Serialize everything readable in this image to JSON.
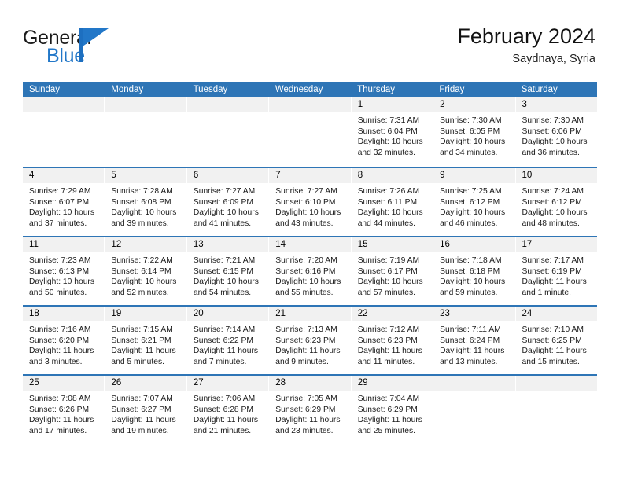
{
  "brand": {
    "name_top": "General",
    "name_bottom": "Blue",
    "mark": "triangle-logo",
    "accent_color": "#2277c8"
  },
  "header": {
    "title": "February 2024",
    "subtitle": "Saydnaya, Syria"
  },
  "theme": {
    "header_blue": "#2e75b6",
    "daynum_band": "#f1f1f1",
    "text": "#1a1a1a"
  },
  "weekdays": [
    "Sunday",
    "Monday",
    "Tuesday",
    "Wednesday",
    "Thursday",
    "Friday",
    "Saturday"
  ],
  "weeks": [
    {
      "days": [
        {
          "num": "",
          "sunrise": "",
          "sunset": "",
          "daylight": "",
          "empty": true
        },
        {
          "num": "",
          "sunrise": "",
          "sunset": "",
          "daylight": "",
          "empty": true
        },
        {
          "num": "",
          "sunrise": "",
          "sunset": "",
          "daylight": "",
          "empty": true
        },
        {
          "num": "",
          "sunrise": "",
          "sunset": "",
          "daylight": "",
          "empty": true
        },
        {
          "num": "1",
          "sunrise": "Sunrise: 7:31 AM",
          "sunset": "Sunset: 6:04 PM",
          "daylight": "Daylight: 10 hours and 32 minutes.",
          "empty": false
        },
        {
          "num": "2",
          "sunrise": "Sunrise: 7:30 AM",
          "sunset": "Sunset: 6:05 PM",
          "daylight": "Daylight: 10 hours and 34 minutes.",
          "empty": false
        },
        {
          "num": "3",
          "sunrise": "Sunrise: 7:30 AM",
          "sunset": "Sunset: 6:06 PM",
          "daylight": "Daylight: 10 hours and 36 minutes.",
          "empty": false
        }
      ]
    },
    {
      "days": [
        {
          "num": "4",
          "sunrise": "Sunrise: 7:29 AM",
          "sunset": "Sunset: 6:07 PM",
          "daylight": "Daylight: 10 hours and 37 minutes.",
          "empty": false
        },
        {
          "num": "5",
          "sunrise": "Sunrise: 7:28 AM",
          "sunset": "Sunset: 6:08 PM",
          "daylight": "Daylight: 10 hours and 39 minutes.",
          "empty": false
        },
        {
          "num": "6",
          "sunrise": "Sunrise: 7:27 AM",
          "sunset": "Sunset: 6:09 PM",
          "daylight": "Daylight: 10 hours and 41 minutes.",
          "empty": false
        },
        {
          "num": "7",
          "sunrise": "Sunrise: 7:27 AM",
          "sunset": "Sunset: 6:10 PM",
          "daylight": "Daylight: 10 hours and 43 minutes.",
          "empty": false
        },
        {
          "num": "8",
          "sunrise": "Sunrise: 7:26 AM",
          "sunset": "Sunset: 6:11 PM",
          "daylight": "Daylight: 10 hours and 44 minutes.",
          "empty": false
        },
        {
          "num": "9",
          "sunrise": "Sunrise: 7:25 AM",
          "sunset": "Sunset: 6:12 PM",
          "daylight": "Daylight: 10 hours and 46 minutes.",
          "empty": false
        },
        {
          "num": "10",
          "sunrise": "Sunrise: 7:24 AM",
          "sunset": "Sunset: 6:12 PM",
          "daylight": "Daylight: 10 hours and 48 minutes.",
          "empty": false
        }
      ]
    },
    {
      "days": [
        {
          "num": "11",
          "sunrise": "Sunrise: 7:23 AM",
          "sunset": "Sunset: 6:13 PM",
          "daylight": "Daylight: 10 hours and 50 minutes.",
          "empty": false
        },
        {
          "num": "12",
          "sunrise": "Sunrise: 7:22 AM",
          "sunset": "Sunset: 6:14 PM",
          "daylight": "Daylight: 10 hours and 52 minutes.",
          "empty": false
        },
        {
          "num": "13",
          "sunrise": "Sunrise: 7:21 AM",
          "sunset": "Sunset: 6:15 PM",
          "daylight": "Daylight: 10 hours and 54 minutes.",
          "empty": false
        },
        {
          "num": "14",
          "sunrise": "Sunrise: 7:20 AM",
          "sunset": "Sunset: 6:16 PM",
          "daylight": "Daylight: 10 hours and 55 minutes.",
          "empty": false
        },
        {
          "num": "15",
          "sunrise": "Sunrise: 7:19 AM",
          "sunset": "Sunset: 6:17 PM",
          "daylight": "Daylight: 10 hours and 57 minutes.",
          "empty": false
        },
        {
          "num": "16",
          "sunrise": "Sunrise: 7:18 AM",
          "sunset": "Sunset: 6:18 PM",
          "daylight": "Daylight: 10 hours and 59 minutes.",
          "empty": false
        },
        {
          "num": "17",
          "sunrise": "Sunrise: 7:17 AM",
          "sunset": "Sunset: 6:19 PM",
          "daylight": "Daylight: 11 hours and 1 minute.",
          "empty": false
        }
      ]
    },
    {
      "days": [
        {
          "num": "18",
          "sunrise": "Sunrise: 7:16 AM",
          "sunset": "Sunset: 6:20 PM",
          "daylight": "Daylight: 11 hours and 3 minutes.",
          "empty": false
        },
        {
          "num": "19",
          "sunrise": "Sunrise: 7:15 AM",
          "sunset": "Sunset: 6:21 PM",
          "daylight": "Daylight: 11 hours and 5 minutes.",
          "empty": false
        },
        {
          "num": "20",
          "sunrise": "Sunrise: 7:14 AM",
          "sunset": "Sunset: 6:22 PM",
          "daylight": "Daylight: 11 hours and 7 minutes.",
          "empty": false
        },
        {
          "num": "21",
          "sunrise": "Sunrise: 7:13 AM",
          "sunset": "Sunset: 6:23 PM",
          "daylight": "Daylight: 11 hours and 9 minutes.",
          "empty": false
        },
        {
          "num": "22",
          "sunrise": "Sunrise: 7:12 AM",
          "sunset": "Sunset: 6:23 PM",
          "daylight": "Daylight: 11 hours and 11 minutes.",
          "empty": false
        },
        {
          "num": "23",
          "sunrise": "Sunrise: 7:11 AM",
          "sunset": "Sunset: 6:24 PM",
          "daylight": "Daylight: 11 hours and 13 minutes.",
          "empty": false
        },
        {
          "num": "24",
          "sunrise": "Sunrise: 7:10 AM",
          "sunset": "Sunset: 6:25 PM",
          "daylight": "Daylight: 11 hours and 15 minutes.",
          "empty": false
        }
      ]
    },
    {
      "days": [
        {
          "num": "25",
          "sunrise": "Sunrise: 7:08 AM",
          "sunset": "Sunset: 6:26 PM",
          "daylight": "Daylight: 11 hours and 17 minutes.",
          "empty": false
        },
        {
          "num": "26",
          "sunrise": "Sunrise: 7:07 AM",
          "sunset": "Sunset: 6:27 PM",
          "daylight": "Daylight: 11 hours and 19 minutes.",
          "empty": false
        },
        {
          "num": "27",
          "sunrise": "Sunrise: 7:06 AM",
          "sunset": "Sunset: 6:28 PM",
          "daylight": "Daylight: 11 hours and 21 minutes.",
          "empty": false
        },
        {
          "num": "28",
          "sunrise": "Sunrise: 7:05 AM",
          "sunset": "Sunset: 6:29 PM",
          "daylight": "Daylight: 11 hours and 23 minutes.",
          "empty": false
        },
        {
          "num": "29",
          "sunrise": "Sunrise: 7:04 AM",
          "sunset": "Sunset: 6:29 PM",
          "daylight": "Daylight: 11 hours and 25 minutes.",
          "empty": false
        },
        {
          "num": "",
          "sunrise": "",
          "sunset": "",
          "daylight": "",
          "empty": true
        },
        {
          "num": "",
          "sunrise": "",
          "sunset": "",
          "daylight": "",
          "empty": true
        }
      ]
    }
  ]
}
